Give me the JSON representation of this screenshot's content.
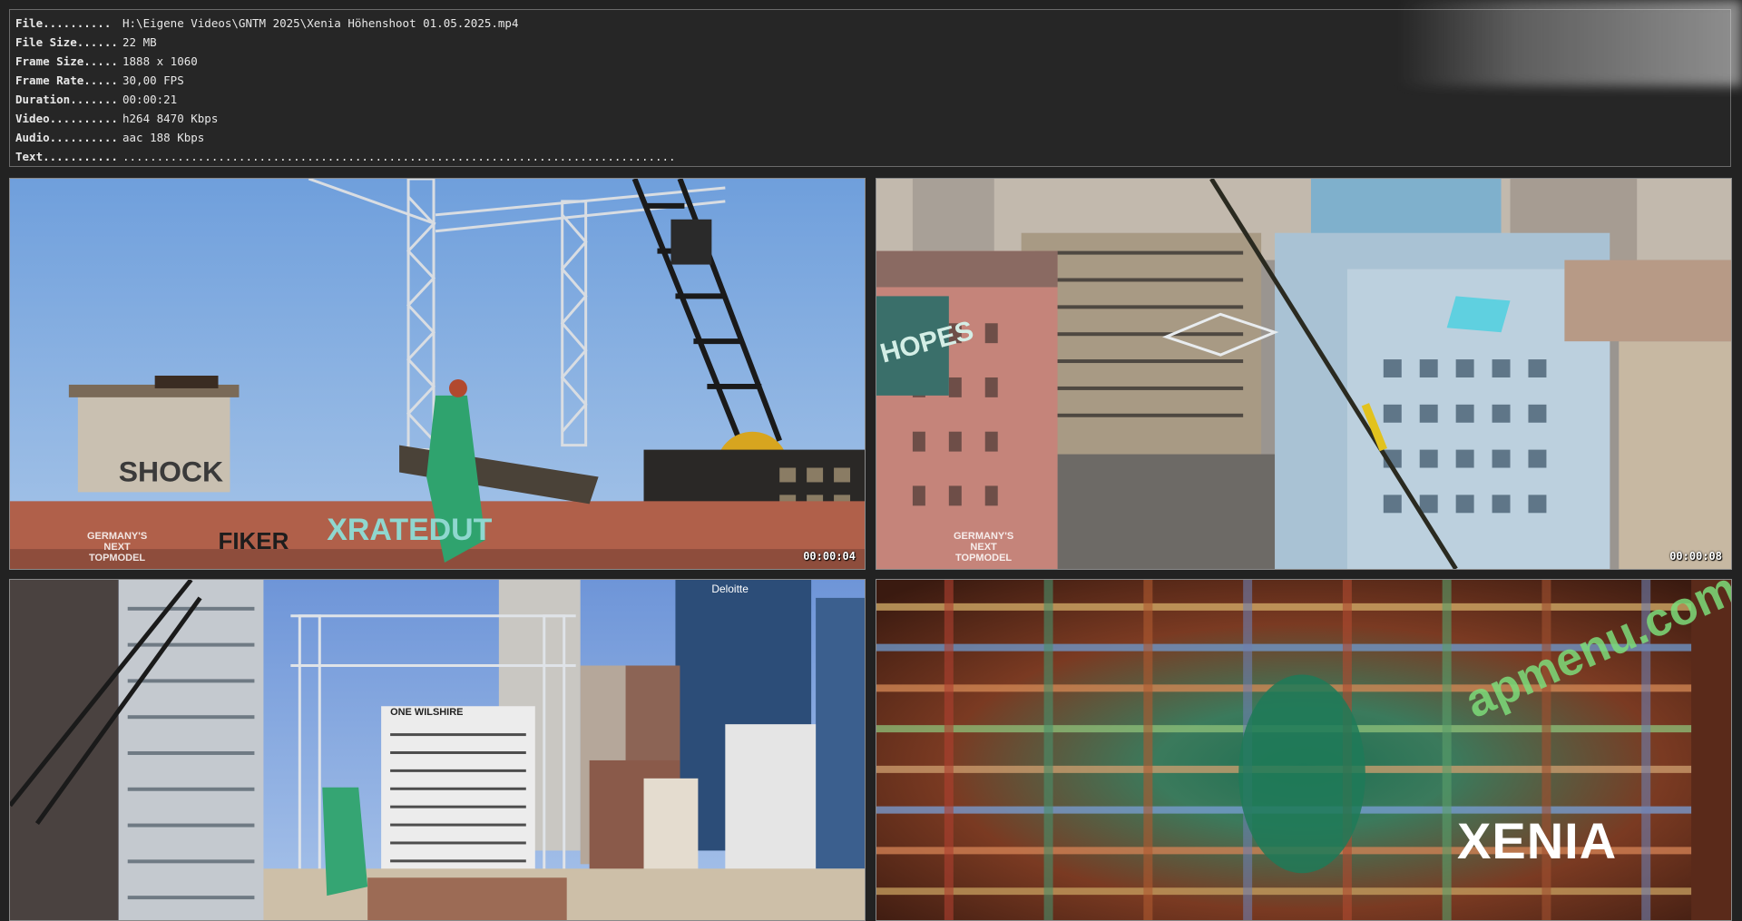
{
  "info": {
    "rows": [
      {
        "key": "File..........",
        "value": "H:\\Eigene Videos\\GNTM 2025\\Xenia Höhenshoot 01.05.2025.mp4"
      },
      {
        "key": "File Size......",
        "value": "22 MB"
      },
      {
        "key": "Frame Size.....",
        "value": "1888 x 1060"
      },
      {
        "key": "Frame Rate.....",
        "value": "30,00 FPS"
      },
      {
        "key": "Duration.......",
        "value": "00:00:21"
      },
      {
        "key": "Video..........",
        "value": "h264 8470 Kbps"
      },
      {
        "key": "Audio..........",
        "value": "aac 188 Kbps"
      },
      {
        "key": "Text...........",
        "value": "................................................................................."
      }
    ]
  },
  "thumbnails": [
    {
      "timestamp": "00:00:04",
      "scene": "crane-rooftop",
      "logo_lines": [
        "GERMANY'S",
        "NEXT",
        "TOPMODEL"
      ],
      "graffiti": [
        "XRATEDUT",
        "FIKER",
        "SHOCK"
      ]
    },
    {
      "timestamp": "00:00:08",
      "scene": "aerial-city",
      "logo_lines": [
        "GERMANY'S",
        "NEXT",
        "TOPMODEL"
      ],
      "graffiti": [
        "HOPES"
      ]
    },
    {
      "timestamp": "",
      "scene": "skyline",
      "logo_lines": [],
      "graffiti": [
        "ONE WILSHIRE",
        "Deloitte"
      ]
    },
    {
      "timestamp": "",
      "scene": "title-card",
      "title": "XENIA",
      "watermark": "apmenu.com"
    }
  ],
  "colors": {
    "background": "#222222",
    "panel_border": "#6a6a6a",
    "info_text": "#e8e8e8",
    "sky": "#7fa8dc",
    "watermark": "#7ddc7a"
  }
}
